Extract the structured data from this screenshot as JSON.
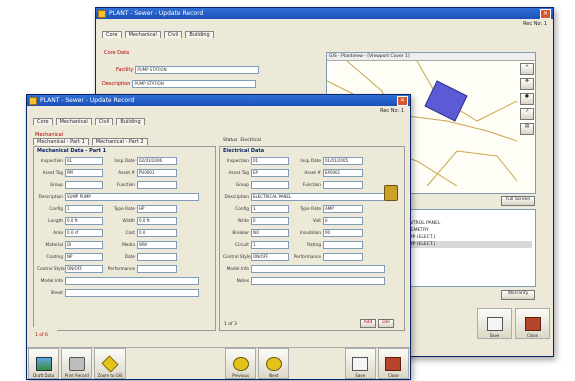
{
  "back_window": {
    "title": "PLANT - Sewer - Update Record",
    "record_label": "Rec No: 1",
    "tabs": [
      "Core",
      "Mechanical",
      "Civil",
      "Building"
    ],
    "section": "Core Data",
    "fields": [
      {
        "label": "Facility",
        "value": "PUMP STATION"
      },
      {
        "label": "Description",
        "value": "PUMP STATION"
      }
    ],
    "map_title": "GIS - Plantview - [Viewport Cover 1]",
    "full_screen": "Full Screen",
    "list_items": [
      "PUMP STATION",
      "STATION 3 - CONTROL PANEL",
      "STATION 3 - TELEMETRY",
      "STATION 4 - PUMP (ELECT.)",
      "STATION 4 - PUMP (ELECT.)"
    ],
    "warranty_btn": "Warranty",
    "save_label": "Save",
    "close_label": "Close"
  },
  "front_window": {
    "title": "PLANT - Sewer - Update Record",
    "record_label": "Rec No: 1",
    "tabs": [
      "Core",
      "Mechanical",
      "Civil",
      "Building"
    ],
    "section": "Mechanical",
    "subtabs": [
      "Mechanical - Part 1",
      "Mechanical - Part 2"
    ],
    "left_panel": {
      "heading": "Mechanical Data - Part 1",
      "rows": [
        {
          "label": "Inspection",
          "value": "01",
          "label2": "Insp Date",
          "value2": "02/01/2006"
        },
        {
          "label": "Asset Tag",
          "value": "PM",
          "label2": "Asset #",
          "value2": "PU0001"
        },
        {
          "label": "Group",
          "value": "",
          "label2": "Function",
          "value2": ""
        },
        {
          "label": "Description",
          "value": "SUMP PUMP",
          "label2": "",
          "value2": ""
        },
        {
          "label": "Config",
          "value": "1",
          "label2": "Type Rate",
          "value2": "HP"
        },
        {
          "label": "Length",
          "value": "0.0 ft",
          "label2": "Width",
          "value2": "0.0 ft"
        },
        {
          "label": "Area",
          "value": "0.0 sf",
          "label2": "Cost",
          "value2": "0.0"
        },
        {
          "label": "Material",
          "value": "DI",
          "label2": "Media",
          "value2": "WW"
        },
        {
          "label": "Coating",
          "value": "NP",
          "label2": "Date",
          "value2": ""
        },
        {
          "label": "Control Style",
          "value": "ON/OFF",
          "label2": "Performance",
          "value2": ""
        },
        {
          "label": "Model Info",
          "value": "",
          "label2": "",
          "value2": ""
        },
        {
          "label": "Sheet",
          "value": "",
          "label2": "",
          "value2": ""
        }
      ]
    },
    "right_panel": {
      "heading": "Electrical Data",
      "status_label": "Status",
      "status_value": "Electrical",
      "rows": [
        {
          "label": "Inspection",
          "value": "01",
          "label2": "Insp Date",
          "value2": "01/01/2005"
        },
        {
          "label": "Asset Tag",
          "value": "EP",
          "label2": "Asset #",
          "value2": "EP0001"
        },
        {
          "label": "Group",
          "value": "",
          "label2": "Function",
          "value2": ""
        },
        {
          "label": "Description",
          "value": "ELECTRICAL PANEL",
          "label2": "",
          "value2": ""
        },
        {
          "label": "Config",
          "value": "1",
          "label2": "Type Rate",
          "value2": "AMP"
        },
        {
          "label": "Write",
          "value": "0",
          "label2": "Volt",
          "value2": "0"
        },
        {
          "label": "Breaker",
          "value": "NO",
          "label2": "Insulation",
          "value2": "00"
        },
        {
          "label": "Circuit",
          "value": "1",
          "label2": "Rating",
          "value2": ""
        },
        {
          "label": "Control Style",
          "value": "ON/OFF",
          "label2": "Performance",
          "value2": ""
        },
        {
          "label": "Model Info",
          "value": "",
          "label2": "",
          "value2": ""
        },
        {
          "label": "Notes",
          "value": "",
          "label2": "",
          "value2": ""
        }
      ],
      "footer": "1 of 3",
      "add_btn": "Add",
      "del_btn": "Del"
    },
    "footer_left": "1 of 6",
    "toolbar": [
      {
        "label": "Draft Data",
        "icon": "map-icon"
      },
      {
        "label": "Print Record",
        "icon": "printer-icon"
      },
      {
        "label": "Zoom to GIS",
        "icon": "zoom-gis-icon"
      },
      {
        "label": "Previous",
        "icon": "prev-icon"
      },
      {
        "label": "Next",
        "icon": "next-icon"
      },
      {
        "label": "Save",
        "icon": "save-icon"
      },
      {
        "label": "Close",
        "icon": "close-door-icon"
      }
    ]
  },
  "colors": {
    "titlebar": "#1b4fb8",
    "window_bg": "#ece9d8",
    "label_red": "#b00000",
    "highlight": "#d8d8d8"
  }
}
